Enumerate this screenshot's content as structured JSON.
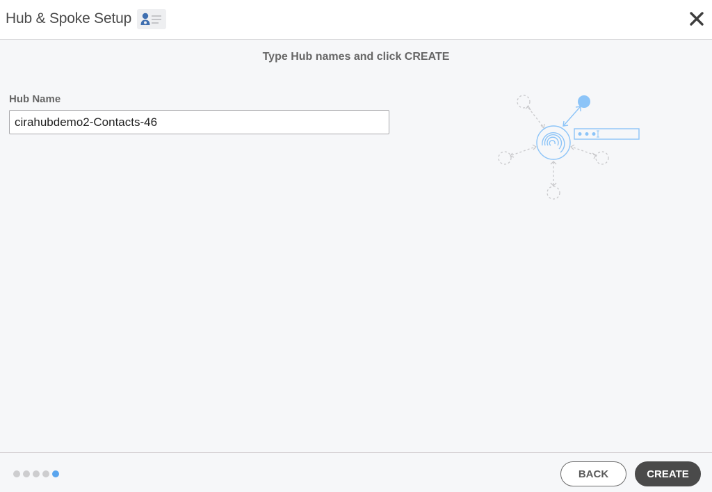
{
  "header": {
    "title": "Hub & Spoke Setup",
    "title_icon": "contact-card-icon",
    "close_icon": "close-icon"
  },
  "main": {
    "instruction": "Type Hub names and click CREATE",
    "hub_name_label": "Hub Name",
    "hub_name_value": "cirahubdemo2-Contacts-46",
    "illustration": "hub-spoke-illustration"
  },
  "footer": {
    "steps_total": 5,
    "current_step": 5,
    "back_label": "BACK",
    "create_label": "CREATE"
  },
  "colors": {
    "accent": "#5aa5ee",
    "illustration_blue": "#8cc4f8",
    "primary_button": "#4a4a4a"
  }
}
